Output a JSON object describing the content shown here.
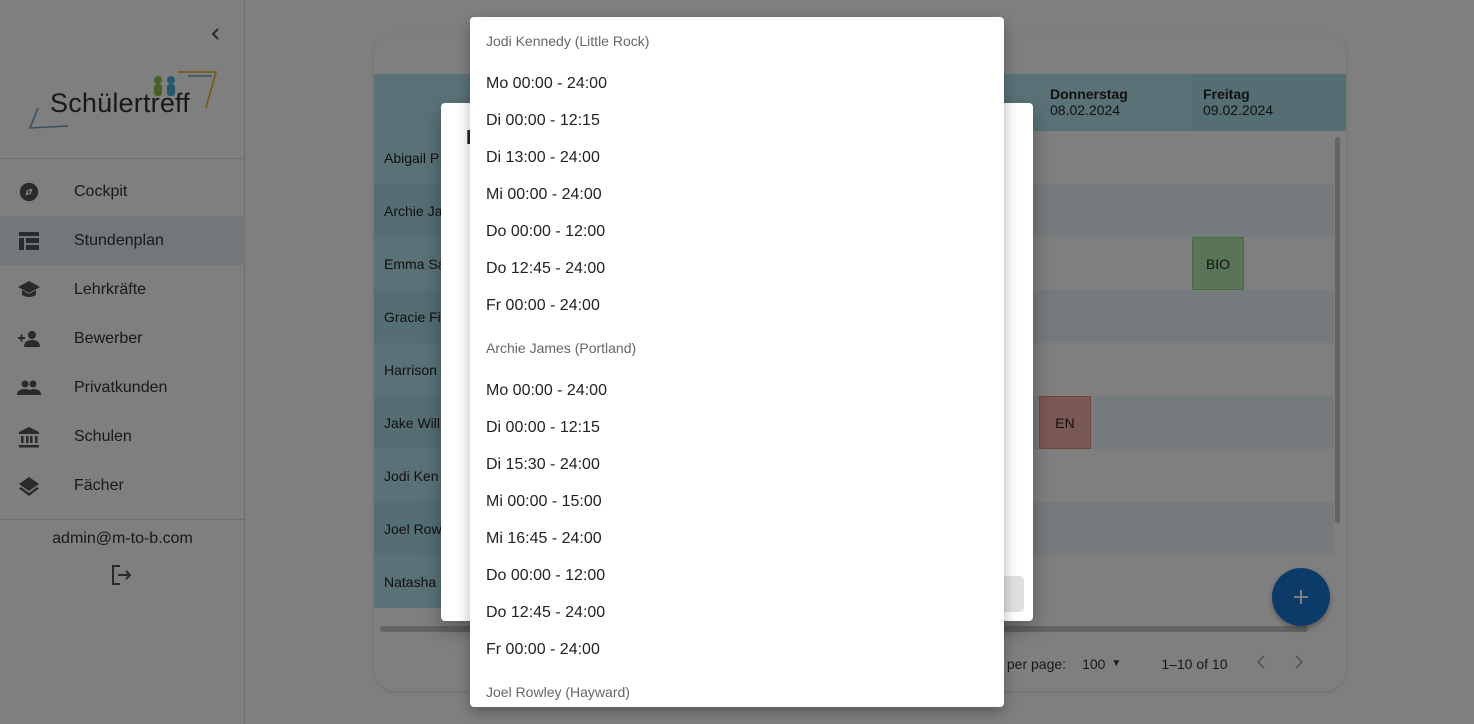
{
  "sidebar": {
    "brand": "Schülertreff",
    "nav": [
      {
        "label": "Cockpit",
        "icon": "compass-icon"
      },
      {
        "label": "Stundenplan",
        "icon": "table-icon"
      },
      {
        "label": "Lehrkräfte",
        "icon": "school-icon"
      },
      {
        "label": "Bewerber",
        "icon": "person-add-icon"
      },
      {
        "label": "Privatkunden",
        "icon": "people-icon"
      },
      {
        "label": "Schulen",
        "icon": "bank-icon"
      },
      {
        "label": "Fächer",
        "icon": "layers-icon"
      }
    ],
    "active_item": "Stundenplan",
    "user_email": "admin@m-to-b.com"
  },
  "timetable": {
    "days": [
      {
        "name": "Donnerstag",
        "date": "08.02.2024"
      },
      {
        "name": "Freitag",
        "date": "09.02.2024"
      }
    ],
    "rows": [
      {
        "name": "Abigail P"
      },
      {
        "name": "Archie Ja"
      },
      {
        "name": "Emma Sa",
        "subject": "BIO"
      },
      {
        "name": "Gracie Fi"
      },
      {
        "name": "Harrison"
      },
      {
        "name": "Jake Will",
        "subject": "EN"
      },
      {
        "name": "Jodi Ken"
      },
      {
        "name": "Joel Row"
      },
      {
        "name": "Natasha"
      }
    ],
    "pagination": {
      "rows_per_page_label": "s per page:",
      "rows_per_page_value": "100",
      "range": "1–10 of 10"
    }
  },
  "dialog": {
    "title_visible": "I"
  },
  "dropdown": {
    "groups": [
      {
        "header": "Jodi Kennedy (Little Rock)",
        "items": [
          "Mo 00:00 - 24:00",
          "Di 00:00 - 12:15",
          "Di 13:00 - 24:00",
          "Mi 00:00 - 24:00",
          "Do 00:00 - 12:00",
          "Do 12:45 - 24:00",
          "Fr 00:00 - 24:00"
        ]
      },
      {
        "header": "Archie James (Portland)",
        "items": [
          "Mo 00:00 - 24:00",
          "Di 00:00 - 12:15",
          "Di 15:30 - 24:00",
          "Mi 00:00 - 15:00",
          "Mi 16:45 - 24:00",
          "Do 00:00 - 12:00",
          "Do 12:45 - 24:00",
          "Fr 00:00 - 24:00"
        ]
      },
      {
        "header": "Joel Rowley (Hayward)",
        "items": []
      }
    ]
  },
  "colors": {
    "accent": "#1976d2",
    "table_header": "#b4e4ef",
    "subject_bio": "#b5e8b0",
    "subject_en": "#f5b0a8"
  }
}
